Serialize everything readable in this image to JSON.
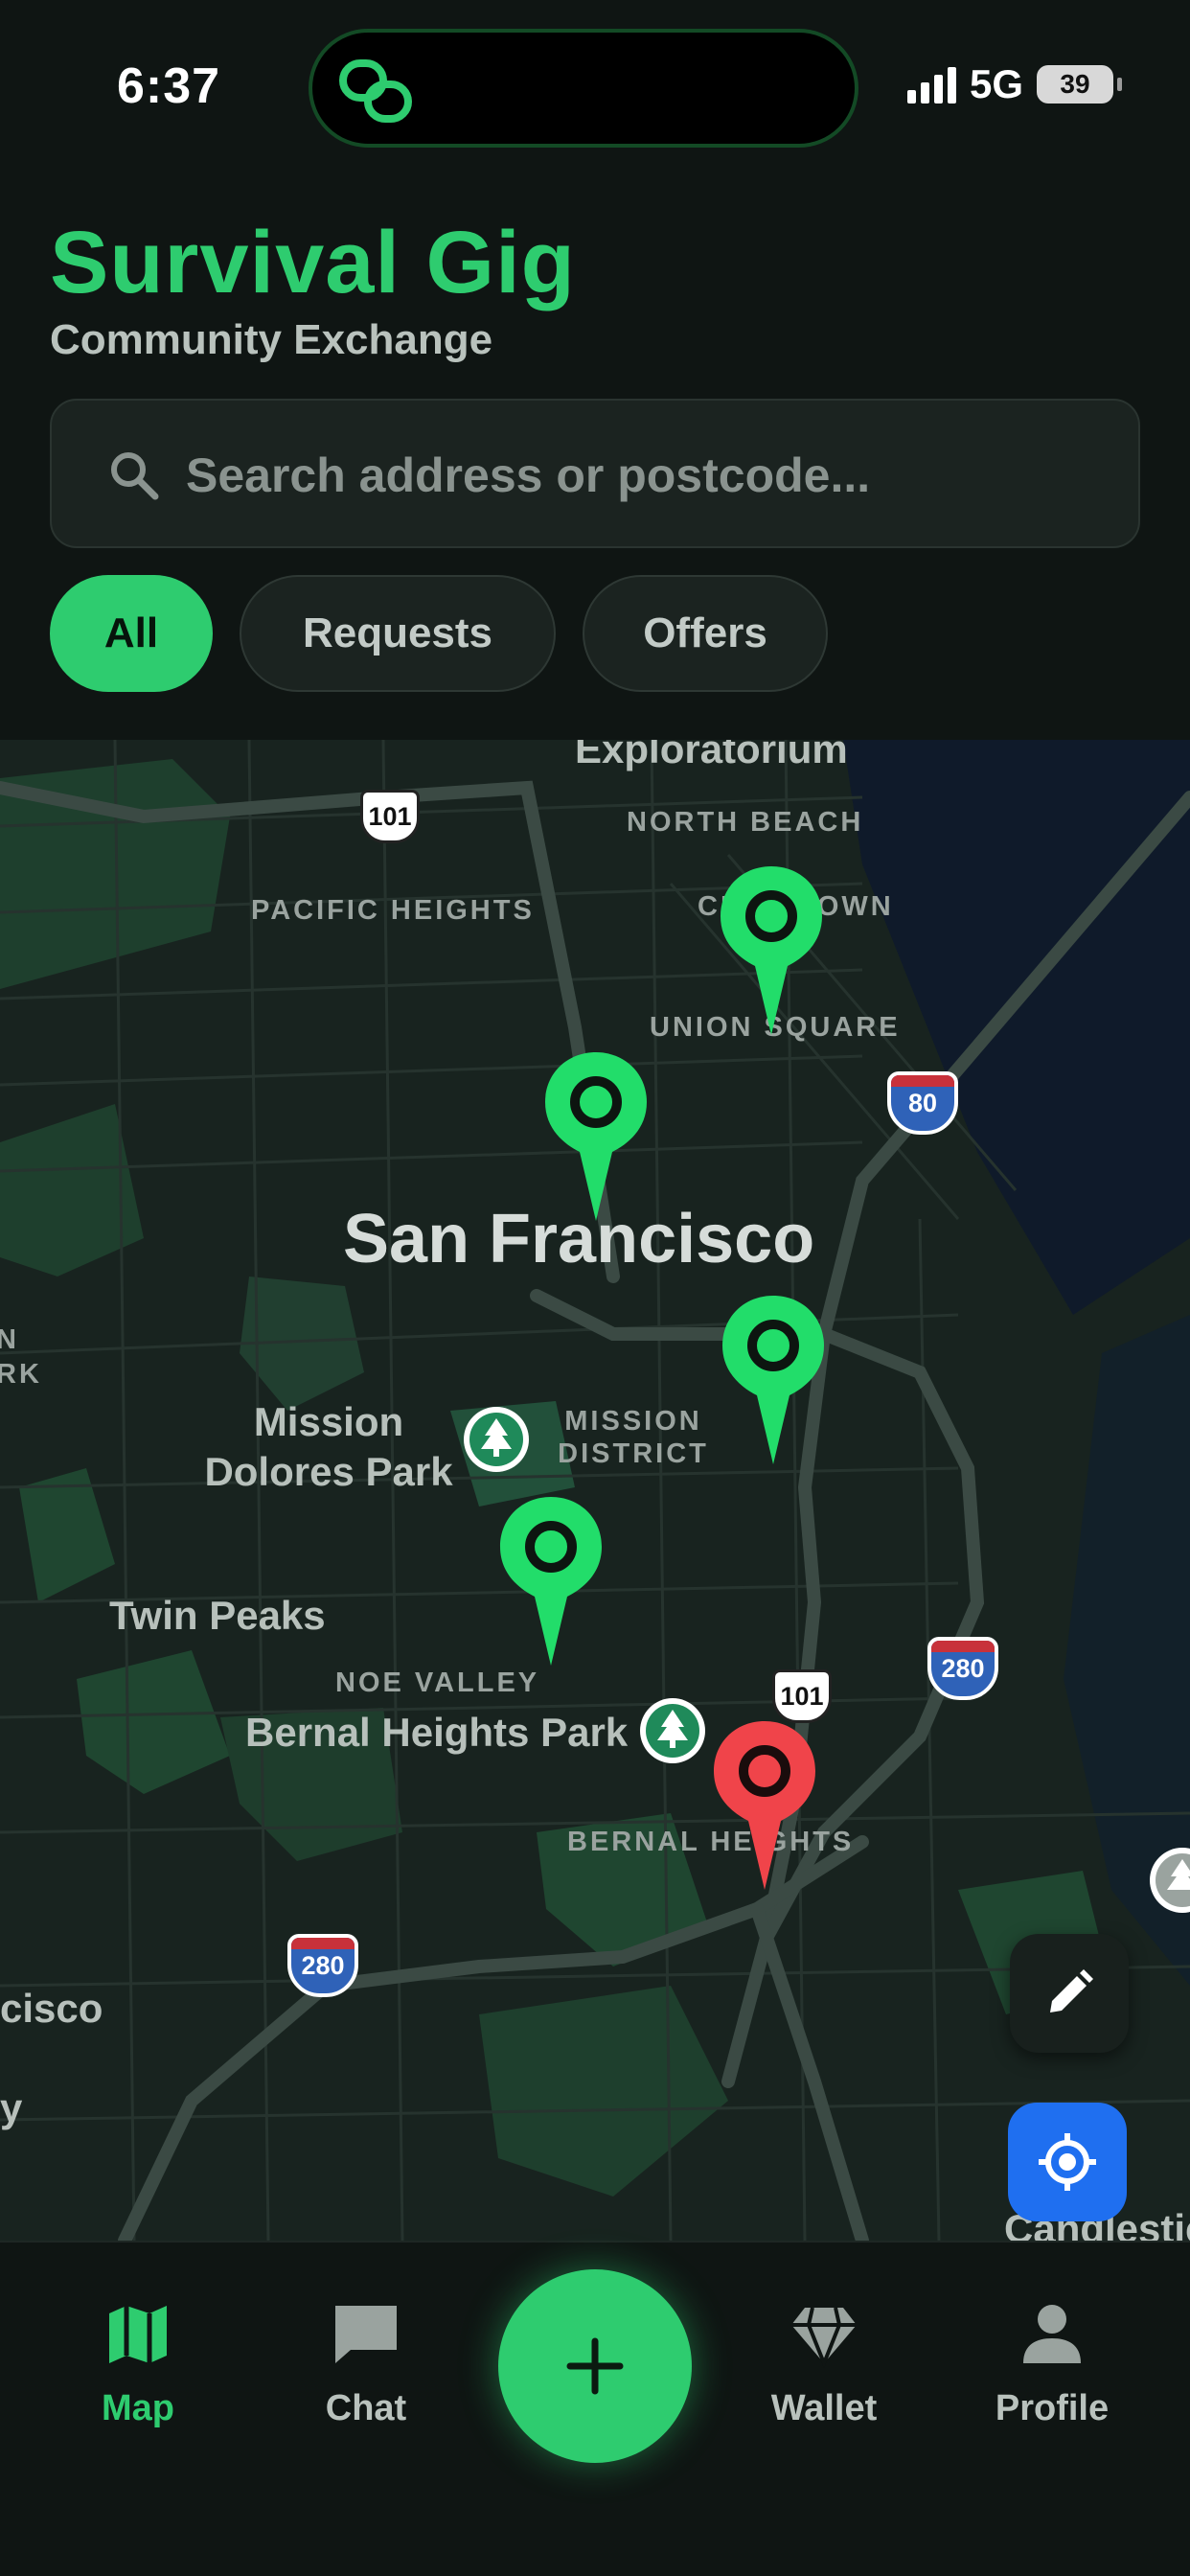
{
  "status_bar": {
    "time": "6:37",
    "network": "5G",
    "battery": "39"
  },
  "header": {
    "title": "Survival Gig",
    "subtitle": "Community Exchange",
    "search_placeholder": "Search address or postcode...",
    "filters": [
      {
        "label": "All",
        "active": true
      },
      {
        "label": "Requests",
        "active": false
      },
      {
        "label": "Offers",
        "active": false
      }
    ]
  },
  "map": {
    "city_label": "San Francisco",
    "neighborhood_labels": [
      "Exploratorium",
      "NORTH BEACH",
      "PACIFIC HEIGHTS",
      "CHINATOWN",
      "UNION SQUARE",
      "MISSION DISTRICT",
      "NOE VALLEY",
      "BERNAL HEIGHTS",
      "N",
      "RK"
    ],
    "place_labels": [
      "Mission Dolores Park",
      "Twin Peaks",
      "Bernal Heights Park",
      "cisco",
      "y",
      "Candlestick"
    ],
    "route_shields": [
      "101",
      "80",
      "101",
      "280",
      "280"
    ],
    "pins": [
      {
        "kind": "offer",
        "color": "#22dd6a"
      },
      {
        "kind": "offer",
        "color": "#22dd6a"
      },
      {
        "kind": "offer",
        "color": "#22dd6a"
      },
      {
        "kind": "offer",
        "color": "#22dd6a"
      },
      {
        "kind": "request",
        "color": "#f0444a"
      }
    ],
    "edit_button_icon": "pencil-icon",
    "locate_button_icon": "locate-icon"
  },
  "bottom_nav": {
    "items": [
      {
        "label": "Map",
        "icon": "map-icon",
        "active": true
      },
      {
        "label": "Chat",
        "icon": "chat-icon",
        "active": false
      },
      {
        "label": "Wallet",
        "icon": "diamond-icon",
        "active": false
      },
      {
        "label": "Profile",
        "icon": "person-icon",
        "active": false
      }
    ],
    "add_button_icon": "plus-icon"
  },
  "colors": {
    "accent": "#2ecc6f",
    "request": "#f0444a",
    "locate": "#1f6ff0",
    "background": "#0f1513"
  }
}
